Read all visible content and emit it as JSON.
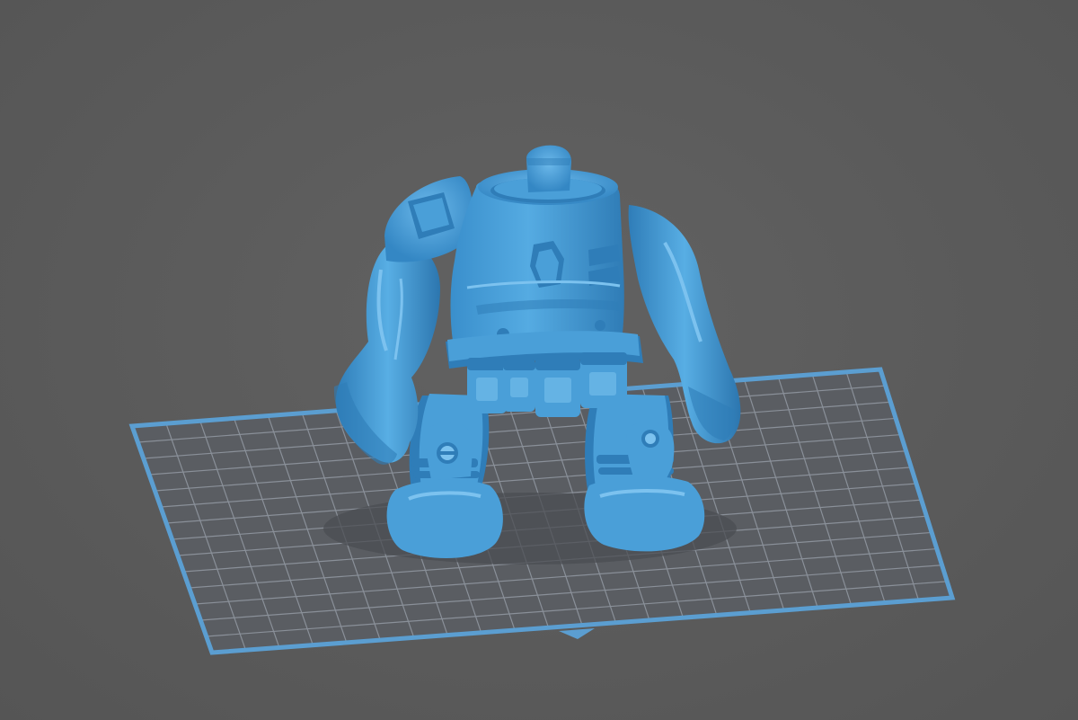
{
  "viewport": {
    "background_color": "#5c5c5c",
    "camera": "perspective"
  },
  "build_plate": {
    "border_color": "#5b9ed1",
    "grid_color": "#8a9099",
    "surface_color": "#5a5d62",
    "grid_columns": 22,
    "grid_rows": 14
  },
  "model": {
    "color": "#4a9fd8",
    "shade_color": "#2f7db8",
    "highlight_color": "#7cc2ef",
    "shadow_color": "#4b4e53"
  },
  "icons": {
    "plate_front_marker": "triangle-down-icon"
  }
}
